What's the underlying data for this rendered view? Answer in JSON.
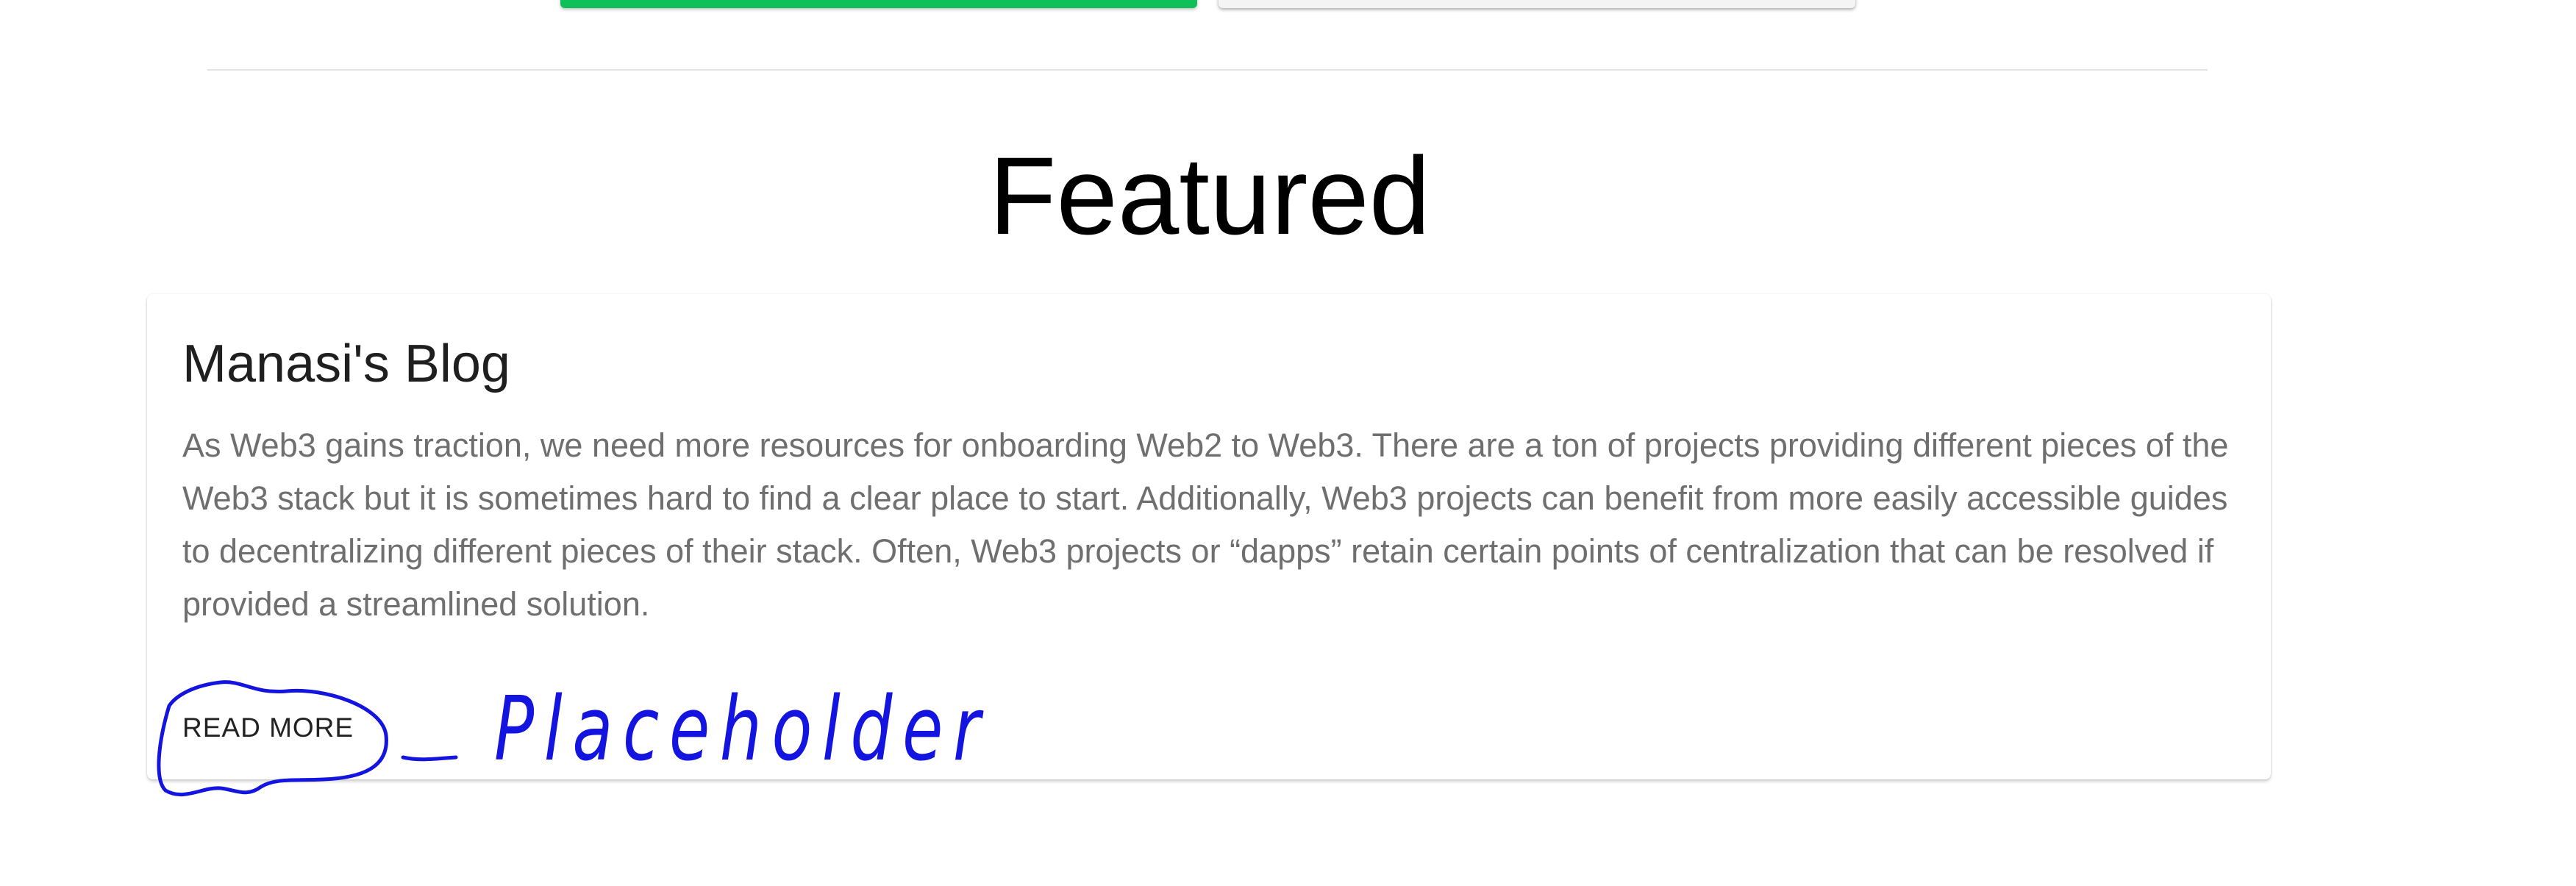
{
  "section": {
    "title": "Featured"
  },
  "card": {
    "title": "Manasi's Blog",
    "body": "As Web3 gains traction, we need more resources for onboarding Web2 to Web3. There are a ton of projects providing different pieces of the Web3 stack but it is sometimes hard to find a clear place to start. Additionally, Web3 projects can benefit from more easily accessible guides to decentralizing different pieces of their stack. Often, Web3 projects or “dapps” retain certain points of centralization that can be resolved if provided a streamlined solution.",
    "action_label": "READ MORE"
  },
  "annotation": {
    "text": "Placeholder",
    "color": "#1414e0"
  },
  "colors": {
    "primary_button": "#0fbf5a",
    "secondary_button": "#f4f4f4"
  }
}
